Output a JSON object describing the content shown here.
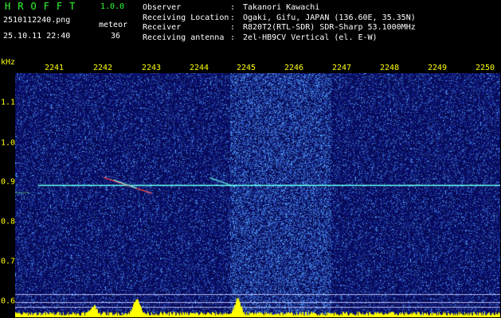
{
  "header": {
    "app_title": "HROFFT",
    "version": "1.0.0",
    "filename": "2510112240.png",
    "datetime": "25.10.11 22:40",
    "meteor_label": "meteor",
    "meteor_count": "36"
  },
  "info": [
    {
      "key": "Observer",
      "value": "Takanori Kawachi"
    },
    {
      "key": "Receiving Location",
      "value": "Ogaki, Gifu, JAPAN (136.60E, 35.35N)"
    },
    {
      "key": "Receiver",
      "value": "R820T2(RTL-SDR) SDR-Sharp 53.1000MHz"
    },
    {
      "key": "Receiving antenna",
      "value": "2el-HB9CV Vertical (el. E-W)"
    }
  ],
  "axes": {
    "y_unit": "kHz",
    "x_ticks": [
      "2241",
      "2242",
      "2243",
      "2244",
      "2245",
      "2246",
      "2247",
      "2248",
      "2249",
      "2250"
    ],
    "y_ticks": [
      "1.1",
      "1.0",
      "0.9",
      "0.8",
      "0.7",
      "0.6"
    ]
  },
  "colors": {
    "title_green": "#33ff33",
    "axis_yellow": "#ffff00",
    "background_blue": "#0a0f6e",
    "signal_cyan": "#66ffee",
    "meteor_red": "#ff5050",
    "histogram_yellow": "#ffff00"
  },
  "spectrogram": {
    "x_range": [
      2240.6,
      2250.2
    ],
    "y_range": [
      0.56,
      1.19
    ],
    "carrier_khz": 0.9,
    "carrier_start_min": 2241.05,
    "bright_band_min": [
      2244.85,
      2246.85
    ],
    "reference_lines_khz": [
      0.62,
      0.6,
      0.587
    ],
    "meteors": [
      {
        "x0": 2242.35,
        "y0": 0.921,
        "x1": 2243.3,
        "y1": 0.88
      },
      {
        "x0": 2242.55,
        "y0": 0.915,
        "x1": 2243.0,
        "y1": 0.893
      },
      {
        "x0": 2244.45,
        "y0": 0.92,
        "x1": 2244.95,
        "y1": 0.897
      }
    ]
  }
}
